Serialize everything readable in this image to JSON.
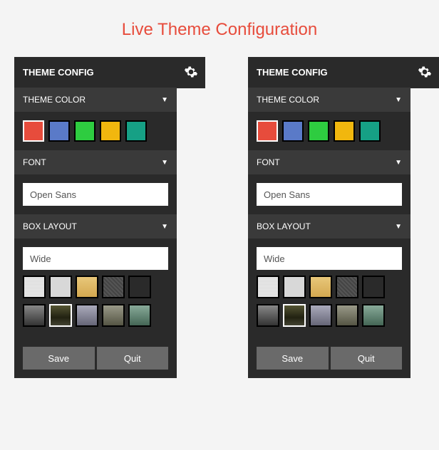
{
  "page_title": "Live Theme Configuration",
  "panel": {
    "header": "THEME CONFIG",
    "sections": {
      "theme_color": {
        "label": "THEME COLOR",
        "colors": [
          "#e74c3c",
          "#5a7ac8",
          "#2ecc40",
          "#f1b70e",
          "#16a085"
        ],
        "selected_index": 0
      },
      "font": {
        "label": "FONT",
        "value": "Open Sans"
      },
      "box_layout": {
        "label": "BOX LAYOUT",
        "value": "Wide",
        "pattern_selected_row1": -1,
        "pattern_selected_row2": 1
      }
    },
    "buttons": {
      "save": "Save",
      "quit": "Quit"
    }
  }
}
